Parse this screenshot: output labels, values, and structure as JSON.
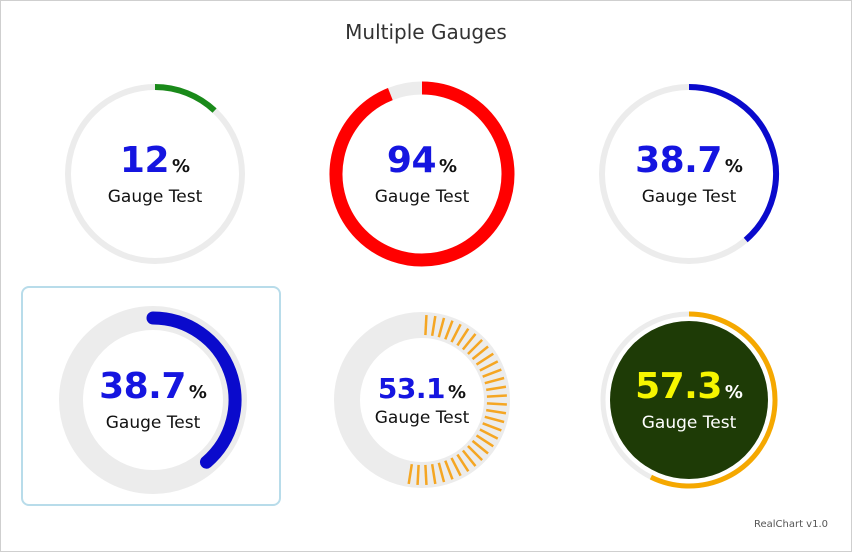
{
  "chart_data": {
    "type": "gauge",
    "title": "Multiple Gauges",
    "credits": "RealChart v1.0",
    "gauges": [
      {
        "value": 12,
        "value_text": "12",
        "unit": "%",
        "label": "Gauge Test",
        "color": "#1a8a1a",
        "value_color": "#1515e0",
        "style": "thin"
      },
      {
        "value": 94,
        "value_text": "94",
        "unit": "%",
        "label": "Gauge Test",
        "color": "#ff0000",
        "value_color": "#1515e0",
        "style": "thick"
      },
      {
        "value": 38.7,
        "value_text": "38.7",
        "unit": "%",
        "label": "Gauge Test",
        "color": "#0a0acc",
        "value_color": "#1515e0",
        "style": "thin"
      },
      {
        "value": 38.7,
        "value_text": "38.7",
        "unit": "%",
        "label": "Gauge Test",
        "color": "#0a0acc",
        "value_color": "#1515e0",
        "style": "rounded",
        "selected": true
      },
      {
        "value": 53.1,
        "value_text": "53.1",
        "unit": "%",
        "label": "Gauge Test",
        "color": "#f5a623",
        "value_color": "#1515e0",
        "style": "striped"
      },
      {
        "value": 57.3,
        "value_text": "57.3",
        "unit": "%",
        "label": "Gauge Test",
        "color": "#f5a800",
        "value_color": "#f6f600",
        "style": "filled",
        "fill": "#1e3b06",
        "label_color": "#ffffff"
      }
    ]
  }
}
